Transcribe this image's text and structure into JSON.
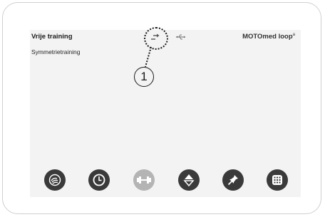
{
  "header": {
    "title": "Vrije training",
    "subtitle": "Symmetrietraining",
    "brand": "MOTOmed loop",
    "brand_mark": "a"
  },
  "status_icons": [
    "symmetry-icon",
    "usb-icon"
  ],
  "callout": {
    "number": "1"
  },
  "toolbar": {
    "buttons": [
      {
        "name": "therapist-hand-icon",
        "state": "active"
      },
      {
        "name": "clock-icon",
        "state": "active"
      },
      {
        "name": "dumbbell-icon",
        "state": "disabled"
      },
      {
        "name": "up-down-icon",
        "state": "active"
      },
      {
        "name": "pin-icon",
        "state": "active"
      },
      {
        "name": "grid-menu-icon",
        "state": "active"
      }
    ]
  },
  "colors": {
    "screen_bg": "#f3f3f3",
    "button_dark": "#3a3a3a",
    "button_disabled": "#b4b4b4"
  }
}
